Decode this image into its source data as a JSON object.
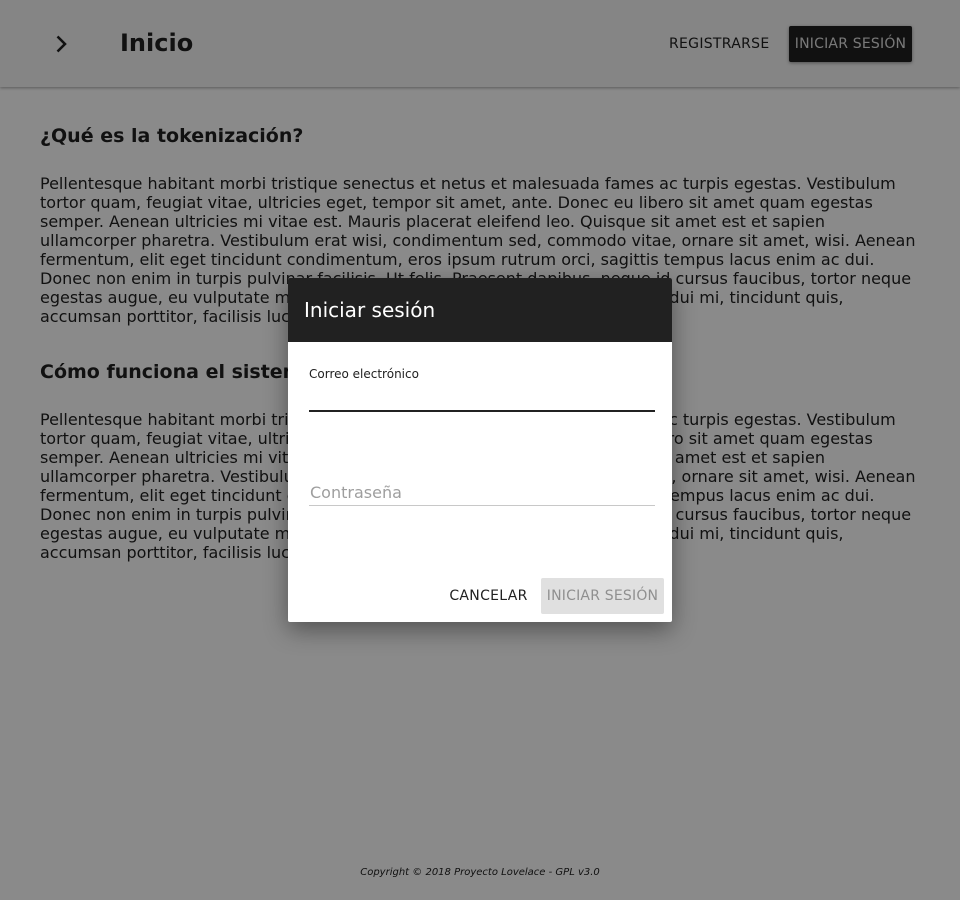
{
  "header": {
    "menu_icon": "chevron-right-icon",
    "title": "Inicio",
    "register_label": "REGISTRARSE",
    "login_label": "INICIAR SESIÓN"
  },
  "content": {
    "sections": [
      {
        "heading": "¿Qué es la tokenización?",
        "text": "Pellentesque habitant morbi tristique senectus et netus et malesuada fames ac turpis egestas. Vestibulum tortor quam, feugiat vitae, ultricies eget, tempor sit amet, ante. Donec eu libero sit amet quam egestas semper. Aenean ultricies mi vitae est. Mauris placerat eleifend leo. Quisque sit amet est et sapien ullamcorper pharetra. Vestibulum erat wisi, condimentum sed, commodo vitae, ornare sit amet, wisi. Aenean fermentum, elit eget tincidunt condimentum, eros ipsum rutrum orci, sagittis tempus lacus enim ac dui. Donec non enim in turpis pulvinar facilisis. Ut felis. Praesent dapibus, neque id cursus faucibus, tortor neque egestas augue, eu vulputate magna eros eu erat. Aliquam erat volutpat. Nam dui mi, tincidunt quis, accumsan porttitor, facilisis luctus, metus"
      },
      {
        "heading": "Cómo funciona el sistema",
        "text": "Pellentesque habitant morbi tristique senectus et netus et malesuada fames ac turpis egestas. Vestibulum tortor quam, feugiat vitae, ultricies eget, tempor sit amet, ante. Donec eu libero sit amet quam egestas semper. Aenean ultricies mi vitae est. Mauris placerat eleifend leo. Quisque sit amet est et sapien ullamcorper pharetra. Vestibulum erat wisi, condimentum sed, commodo vitae, ornare sit amet, wisi. Aenean fermentum, elit eget tincidunt condimentum, eros ipsum rutrum orci, sagittis tempus lacus enim ac dui. Donec non enim in turpis pulvinar facilisis. Ut felis. Praesent dapibus, neque id cursus faucibus, tortor neque egestas augue, eu vulputate magna eros eu erat. Aliquam erat volutpat. Nam dui mi, tincidunt quis, accumsan porttitor, facilisis luctus, metus"
      }
    ]
  },
  "footer": {
    "copyright": "Copyright © 2018 Proyecto Lovelace - GPL v3.0"
  },
  "dialog": {
    "title": "Iniciar sesión",
    "email": {
      "label": "Correo electrónico",
      "value": ""
    },
    "password": {
      "placeholder": "Contraseña",
      "value": ""
    },
    "cancel_label": "CANCELAR",
    "submit_label": "INICIAR SESIÓN"
  },
  "colors": {
    "primary": "#212121",
    "appbar_background": "#f5f5f5",
    "disabled_button_background": "#e0e0e0",
    "disabled_button_text": "#8f8f8f"
  }
}
